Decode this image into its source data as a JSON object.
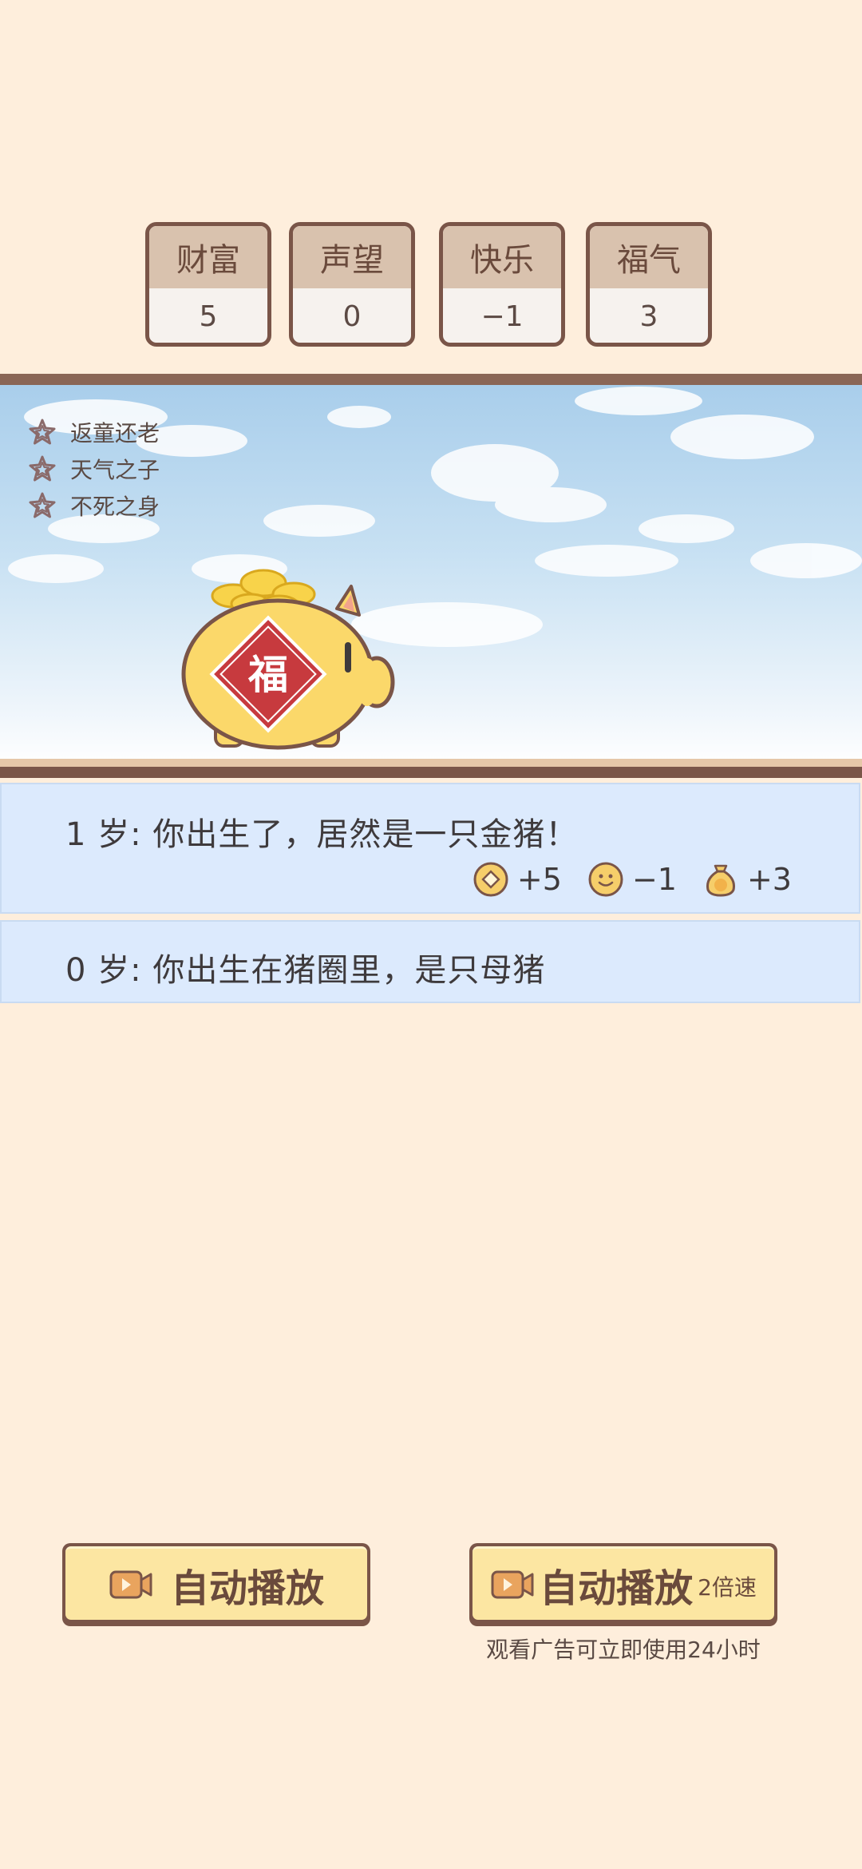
{
  "stats": [
    {
      "label": "财富",
      "value": "5"
    },
    {
      "label": "声望",
      "value": "0"
    },
    {
      "label": "快乐",
      "value": "−1"
    },
    {
      "label": "福气",
      "value": "3"
    }
  ],
  "traits": [
    {
      "icon": "star-outline-icon",
      "label": "返童还老"
    },
    {
      "icon": "star-outline-icon",
      "label": "天气之子"
    },
    {
      "icon": "star-outline-icon",
      "label": "不死之身"
    }
  ],
  "character": {
    "badge": "福",
    "color": "#FBD86A"
  },
  "events": [
    {
      "age": "1",
      "age_unit": "岁",
      "text": "你出生了，居然是一只金猪！",
      "effects": [
        {
          "icon": "coin-icon",
          "value": "+5"
        },
        {
          "icon": "smiley-icon",
          "value": "−1"
        },
        {
          "icon": "luck-bag-icon",
          "value": "+3"
        }
      ]
    },
    {
      "age": "0",
      "age_unit": "岁",
      "text": "你出生在猪圈里，是只母猪"
    }
  ],
  "buttons": {
    "autoplay_label": "自动播放",
    "autoplay_fast_label": "自动播放",
    "autoplay_fast_speed": "2倍速",
    "ad_note": "观看广告可立即使用24小时"
  },
  "colors": {
    "background": "#FEEEDC",
    "card_header": "#D9C2AE",
    "border_brown": "#7A5548",
    "event_bg": "#DCEAFD",
    "button_fill": "#FCE6A2"
  }
}
